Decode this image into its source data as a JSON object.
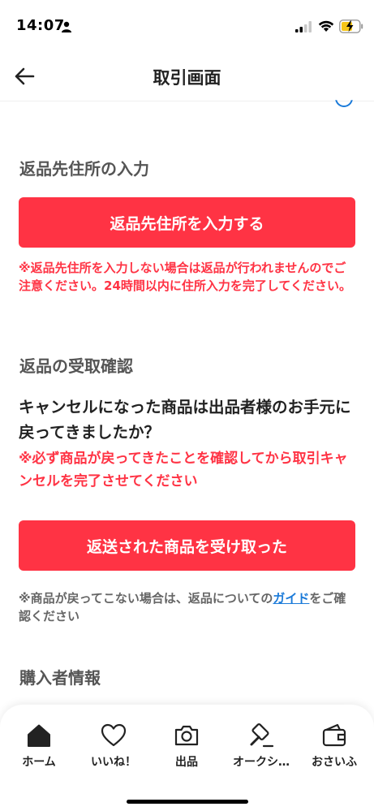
{
  "status_bar": {
    "time": "14:07"
  },
  "header": {
    "title": "取引画面"
  },
  "return_address": {
    "heading": "返品先住所の入力",
    "button_label": "返品先住所を入力する",
    "warning": "※返品先住所を入力しない場合は返品が行われませんのでご注意ください。24時間以内に住所入力を完了してください。"
  },
  "return_receipt": {
    "heading": "返品の受取確認",
    "question": "キャンセルになった商品は出品者様のお手元に戻ってきましたか？",
    "warning": "※必ず商品が戻ってきたことを確認してから取引キャンセルを完了させてください",
    "button_label": "返送された商品を受け取った",
    "note_prefix": "※商品が戻ってこない場合は、返品についての",
    "note_link": "ガイド",
    "note_suffix": "をご確認ください"
  },
  "buyer_info": {
    "heading": "購入者情報"
  },
  "tabs": [
    {
      "label": "ホーム",
      "icon": "home-icon"
    },
    {
      "label": "いいね！",
      "icon": "heart-icon"
    },
    {
      "label": "出品",
      "icon": "camera-icon"
    },
    {
      "label": "オークシ…",
      "icon": "gavel-icon"
    },
    {
      "label": "おさいふ",
      "icon": "wallet-icon"
    }
  ],
  "colors": {
    "accent": "#ff3344",
    "link": "#1a7ad9"
  }
}
